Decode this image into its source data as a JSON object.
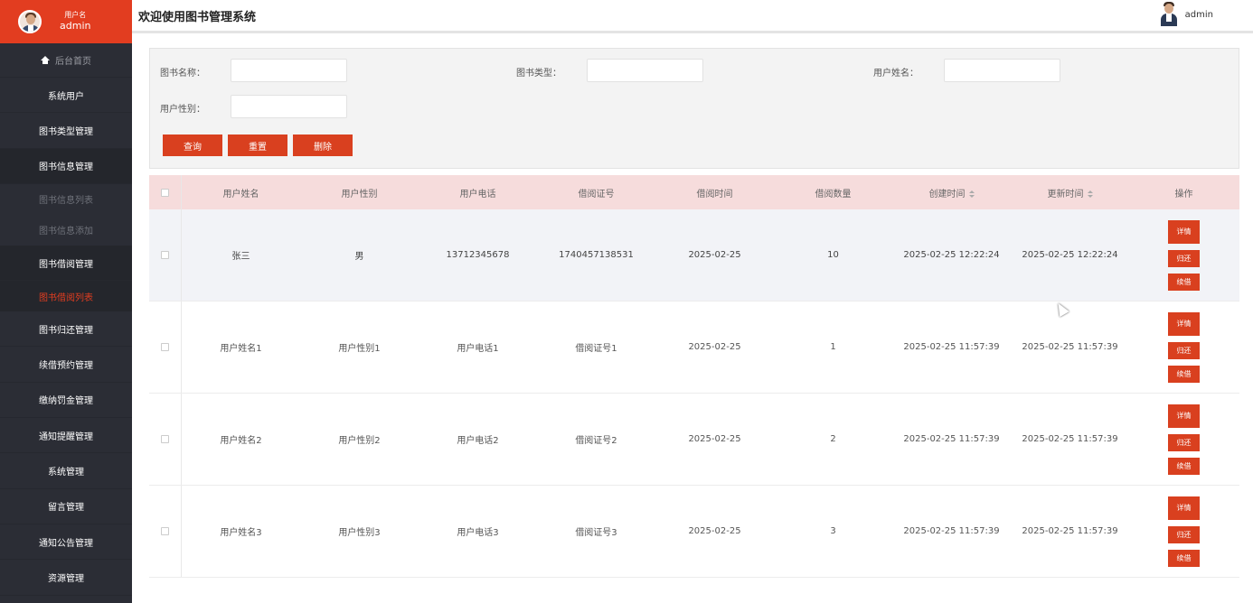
{
  "sidebar": {
    "user_label": "用户名",
    "user_name": "admin",
    "home": "后台首页",
    "items": [
      "系统用户",
      "图书类型管理",
      "图书信息管理",
      "图书信息列表",
      "图书信息添加",
      "图书借阅管理",
      "图书借阅列表",
      "图书归还管理",
      "续借预约管理",
      "缴纳罚金管理",
      "通知提醒管理",
      "系统管理",
      "留言管理",
      "通知公告管理",
      "资源管理"
    ]
  },
  "header": {
    "title": "欢迎使用图书管理系统",
    "username": "admin"
  },
  "search": {
    "book_name_label": "图书名称：",
    "book_type_label": "图书类型：",
    "user_name_label": "用户姓名：",
    "user_gender_label": "用户性别：",
    "query_button": "查询",
    "reset_button": "重置",
    "delete_button": "删除"
  },
  "table": {
    "headers": [
      "用户姓名",
      "用户性别",
      "用户电话",
      "借阅证号",
      "借阅时间",
      "借阅数量",
      "创建时间",
      "更新时间",
      "操作"
    ],
    "rows": [
      [
        "张三",
        "男",
        "13712345678",
        "1740457138531",
        "2025-02-25",
        "10",
        "2025-02-25 12:22:24",
        "2025-02-25 12:22:24"
      ],
      [
        "用户姓名1",
        "用户性别1",
        "用户电话1",
        "借阅证号1",
        "2025-02-25",
        "1",
        "2025-02-25 11:57:39",
        "2025-02-25 11:57:39"
      ],
      [
        "用户姓名2",
        "用户性别2",
        "用户电话2",
        "借阅证号2",
        "2025-02-25",
        "2",
        "2025-02-25 11:57:39",
        "2025-02-25 11:57:39"
      ],
      [
        "用户姓名3",
        "用户性别3",
        "用户电话3",
        "借阅证号3",
        "2025-02-25",
        "3",
        "2025-02-25 11:57:39",
        "2025-02-25 11:57:39"
      ]
    ],
    "actions": {
      "detail": "详情",
      "return": "归还",
      "renew": "续借"
    }
  },
  "colors": {
    "accent": "#e23d20",
    "button": "#d9401f",
    "sidebar_bg": "#2b2d35",
    "table_header_bg": "#f6dcdc"
  }
}
